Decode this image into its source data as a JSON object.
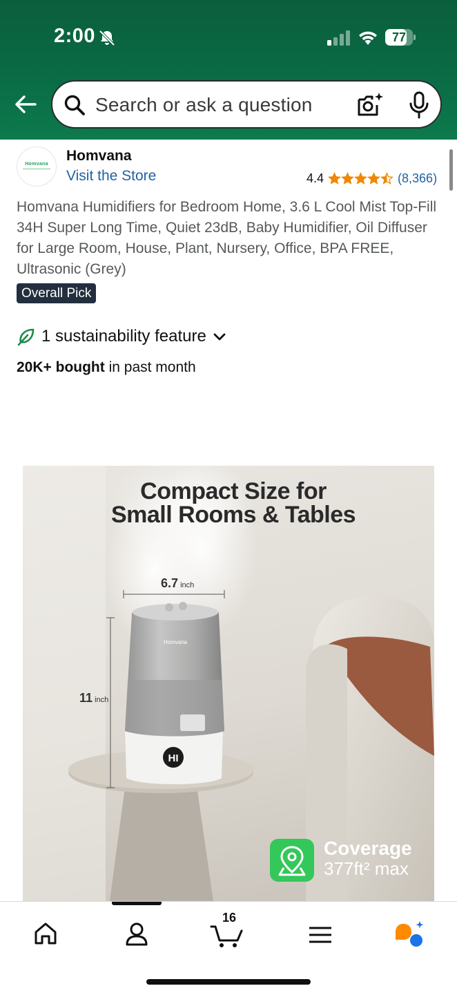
{
  "status_bar": {
    "time": "2:00",
    "battery": "77",
    "battery_level": 0.77,
    "icons": [
      "bell-off-icon",
      "cellular-signal-icon",
      "wifi-icon",
      "battery-icon"
    ]
  },
  "search": {
    "placeholder": "Search or ask a question",
    "icons": [
      "back-arrow-icon",
      "search-icon",
      "camera-icon",
      "microphone-icon"
    ]
  },
  "brand": {
    "name": "Homvana",
    "logo_text": "Homvana",
    "visit_store": "Visit the Store"
  },
  "rating": {
    "value": "4.4",
    "stars": 4.5,
    "reviews": "(8,366)",
    "star_color": "#f08804"
  },
  "product": {
    "title": "Homvana Humidifiers for Bedroom Home, 3.6 L Cool Mist Top-Fill 34H Super Long Time, Quiet 23dB, Baby Humidifier, Oil Diffuser for Large Room, House, Plant, Nursery, Office, BPA FREE, Ultrasonic (Grey)",
    "badge": "Overall Pick",
    "sustainability": "1 sustainability feature",
    "bought_bold": "20K+ bought",
    "bought_rest": " in past month"
  },
  "image": {
    "headline_line1": "Compact Size for",
    "headline_line2": "Small Rooms & Tables",
    "width_value": "6.7",
    "width_unit": " inch",
    "height_value": "11",
    "height_unit": " inch",
    "device_brand": "Homvana",
    "display_text": "HI",
    "coverage_title": "Coverage",
    "coverage_sub": "377ft² max"
  },
  "bottom_nav": {
    "items": [
      "home-icon",
      "account-icon",
      "cart-icon",
      "menu-icon",
      "rufus-icon"
    ],
    "cart_count": "16",
    "active": "account"
  },
  "colors": {
    "header_green": "#0b5e3c",
    "link_blue": "#2162a1",
    "badge_dark": "#232f3e",
    "rufus_orange": "#ff8a00",
    "rufus_blue": "#1a73e8"
  }
}
